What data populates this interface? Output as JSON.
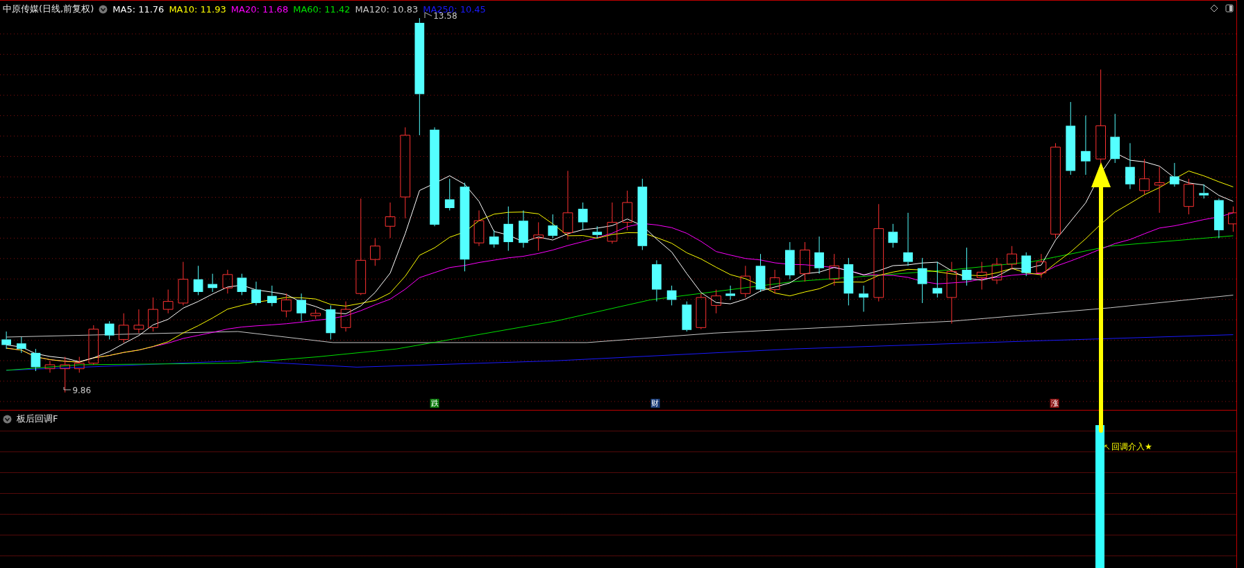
{
  "header": {
    "title": "中原传媒(日线,前复权)",
    "ma": [
      {
        "label": "MA5: 11.76",
        "color": "#ffffff"
      },
      {
        "label": "MA10: 11.93",
        "color": "#ffff00"
      },
      {
        "label": "MA20: 11.68",
        "color": "#ff00ff"
      },
      {
        "label": "MA60: 11.42",
        "color": "#00e000"
      },
      {
        "label": "MA120: 10.83",
        "color": "#c8c8c8"
      },
      {
        "label": "MA250: 10.45",
        "color": "#1a1aff"
      }
    ]
  },
  "price_labels": [
    {
      "text": "13.58"
    },
    {
      "text": "9.86"
    }
  ],
  "event_markers": [
    {
      "text": "跌",
      "color": "#0a7a0a"
    },
    {
      "text": "财",
      "color": "#1a3c78"
    },
    {
      "text": "涨",
      "color": "#8a1010"
    }
  ],
  "indicator": {
    "title": "板后回调F",
    "signal_label": "回调介入★"
  }
}
